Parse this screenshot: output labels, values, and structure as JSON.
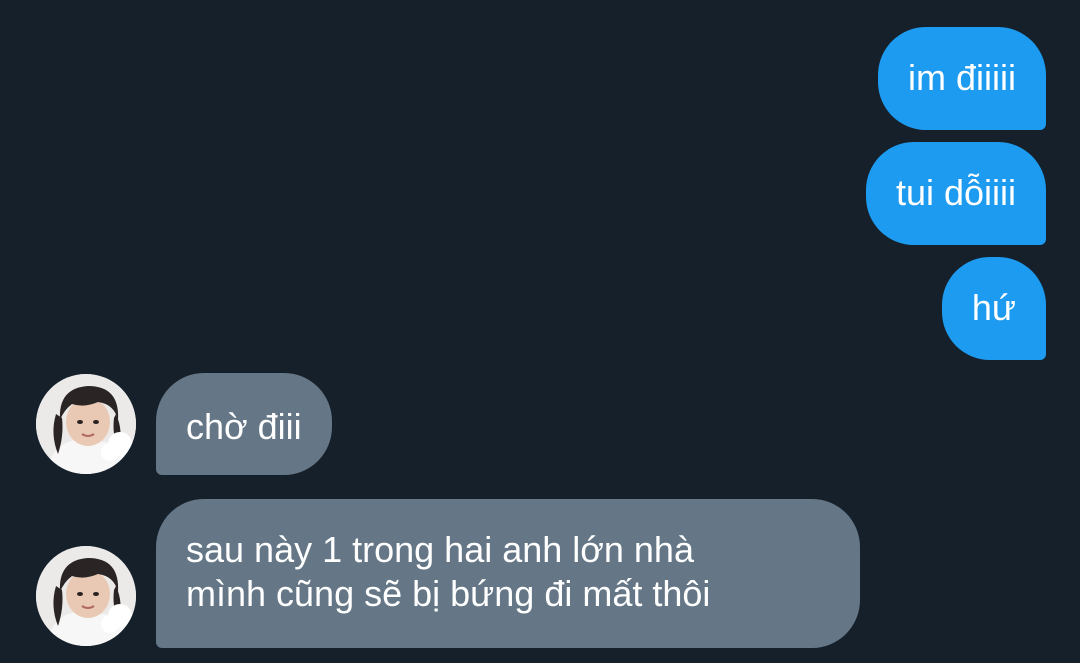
{
  "conversation": {
    "messages": [
      {
        "direction": "sent",
        "text": "im điiiii"
      },
      {
        "direction": "sent",
        "text": "tui dỗiiii"
      },
      {
        "direction": "sent",
        "text": "hứ"
      },
      {
        "direction": "received",
        "text": "chờ điii",
        "avatar": "contact-avatar"
      },
      {
        "direction": "received",
        "lines": [
          "sau này 1 trong hai anh lớn nhà",
          "mình cũng sẽ bị bứng đi mất thôi"
        ],
        "avatar": "contact-avatar"
      }
    ]
  },
  "colors": {
    "background": "#15202b",
    "sent_bubble": "#1d9bf0",
    "received_bubble": "#657786",
    "text": "#ffffff"
  }
}
